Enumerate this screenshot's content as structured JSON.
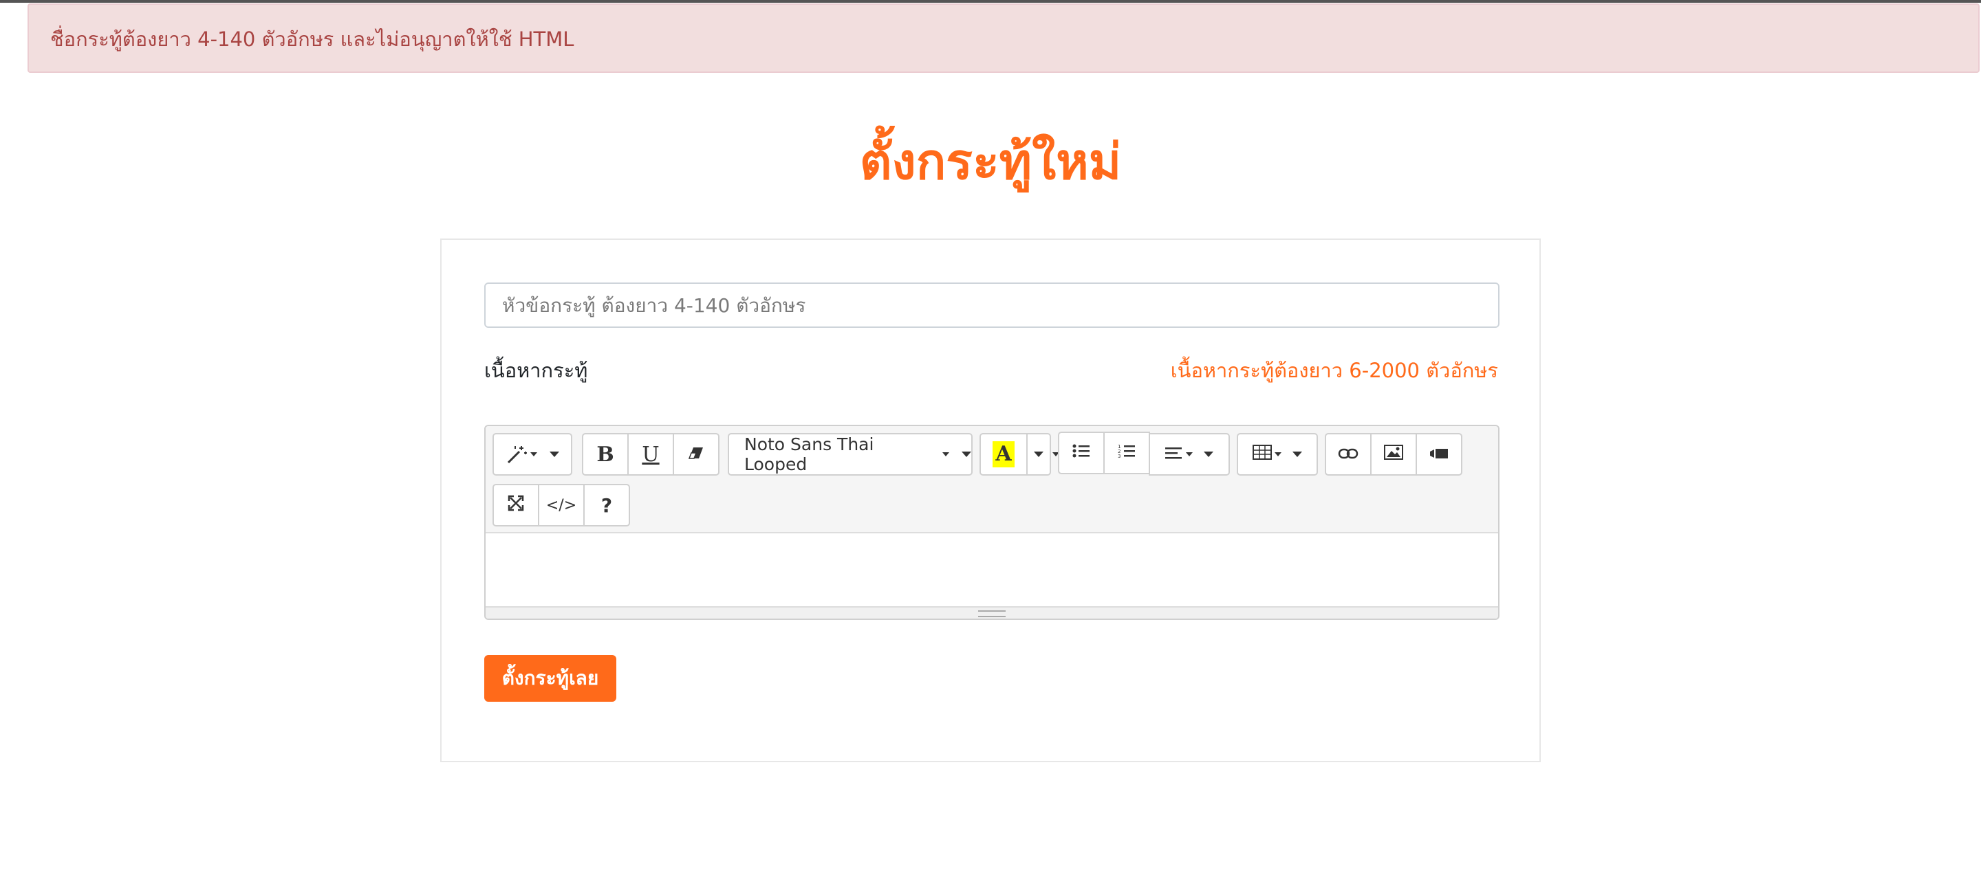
{
  "alert": {
    "message": "ชื่อกระทู้ต้องยาว 4-140 ตัวอักษร และไม่อนุญาตให้ใช้ HTML"
  },
  "page": {
    "title": "ตั้งกระทู้ใหม่"
  },
  "form": {
    "title_placeholder": "หัวข้อกระทู้ ต้องยาว 4-140 ตัวอักษร",
    "title_value": "",
    "content_label": "เนื้อหากระทู้",
    "content_hint": "เนื้อหากระทู้ต้องยาว 6-2000 ตัวอักษร",
    "submit_label": "ตั้งกระทู้เลย"
  },
  "toolbar": {
    "font_name": "Noto Sans Thai Looped",
    "bold": "B",
    "underline": "U",
    "highlight_letter": "A",
    "highlight_color": "#ffff00",
    "code": "</>",
    "help": "?"
  },
  "colors": {
    "accent": "#ff6a1a",
    "alert_bg": "#f2dede",
    "alert_text": "#a94442"
  },
  "icons": [
    "magic-wand-icon",
    "eraser-icon",
    "unordered-list-icon",
    "ordered-list-icon",
    "align-icon",
    "table-icon",
    "link-icon",
    "picture-icon",
    "video-icon",
    "fullscreen-icon",
    "code-view-icon",
    "help-icon"
  ]
}
